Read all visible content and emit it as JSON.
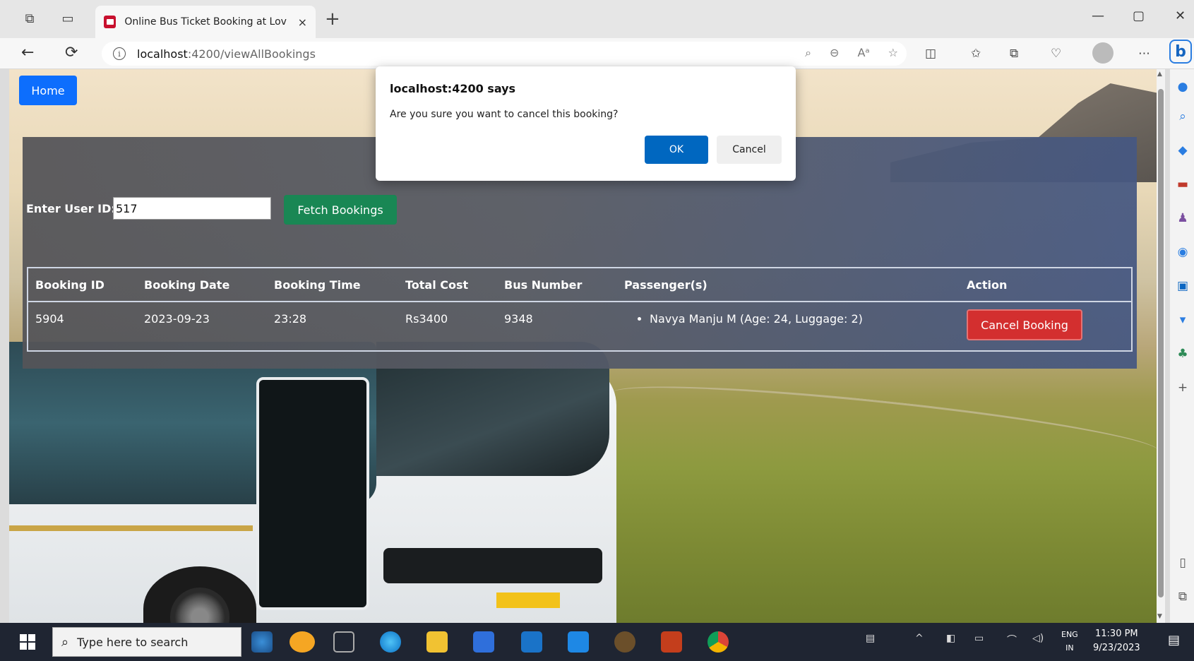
{
  "browser": {
    "tab_title": "Online Bus Ticket Booking at Lov",
    "tab_close": "×",
    "new_tab": "+",
    "url_host": "localhost",
    "url_path": ":4200/viewAllBookings",
    "omnibox_icons": [
      "⌕",
      "⊖",
      "Aᵃ",
      "☆"
    ],
    "toolbar_icons": [
      "◫",
      "✩",
      "⧉",
      "♡",
      "⋯"
    ],
    "bing_label": "b",
    "back": "←",
    "refresh": "⟳",
    "minimize": "—",
    "restore": "▢",
    "close": "✕"
  },
  "page": {
    "home_label": "Home",
    "user_id_label": "Enter User ID:",
    "user_id_value": "517",
    "fetch_label": "Fetch Bookings",
    "table": {
      "headers": [
        "Booking ID",
        "Booking Date",
        "Booking Time",
        "Total Cost",
        "Bus Number",
        "Passenger(s)",
        "Action"
      ],
      "rows": [
        {
          "booking_id": "5904",
          "booking_date": "2023-09-23",
          "booking_time": "23:28",
          "total_cost": "Rs3400",
          "bus_number": "9348",
          "passengers": [
            "Navya Manju M (Age: 24, Luggage: 2)"
          ],
          "action_label": "Cancel Booking"
        }
      ]
    }
  },
  "dialog": {
    "title": "localhost:4200 says",
    "message": "Are you sure you want to cancel this booking?",
    "ok_label": "OK",
    "cancel_label": "Cancel"
  },
  "taskbar": {
    "search_placeholder": "Type here to search",
    "lang_line1": "ENG",
    "lang_line2": "IN",
    "time": "11:30 PM",
    "date": "9/23/2023"
  },
  "colors": {
    "primary": "#0d6efd",
    "success": "#198754",
    "danger": "#d32f2f",
    "dialog_ok": "#0067c0"
  }
}
